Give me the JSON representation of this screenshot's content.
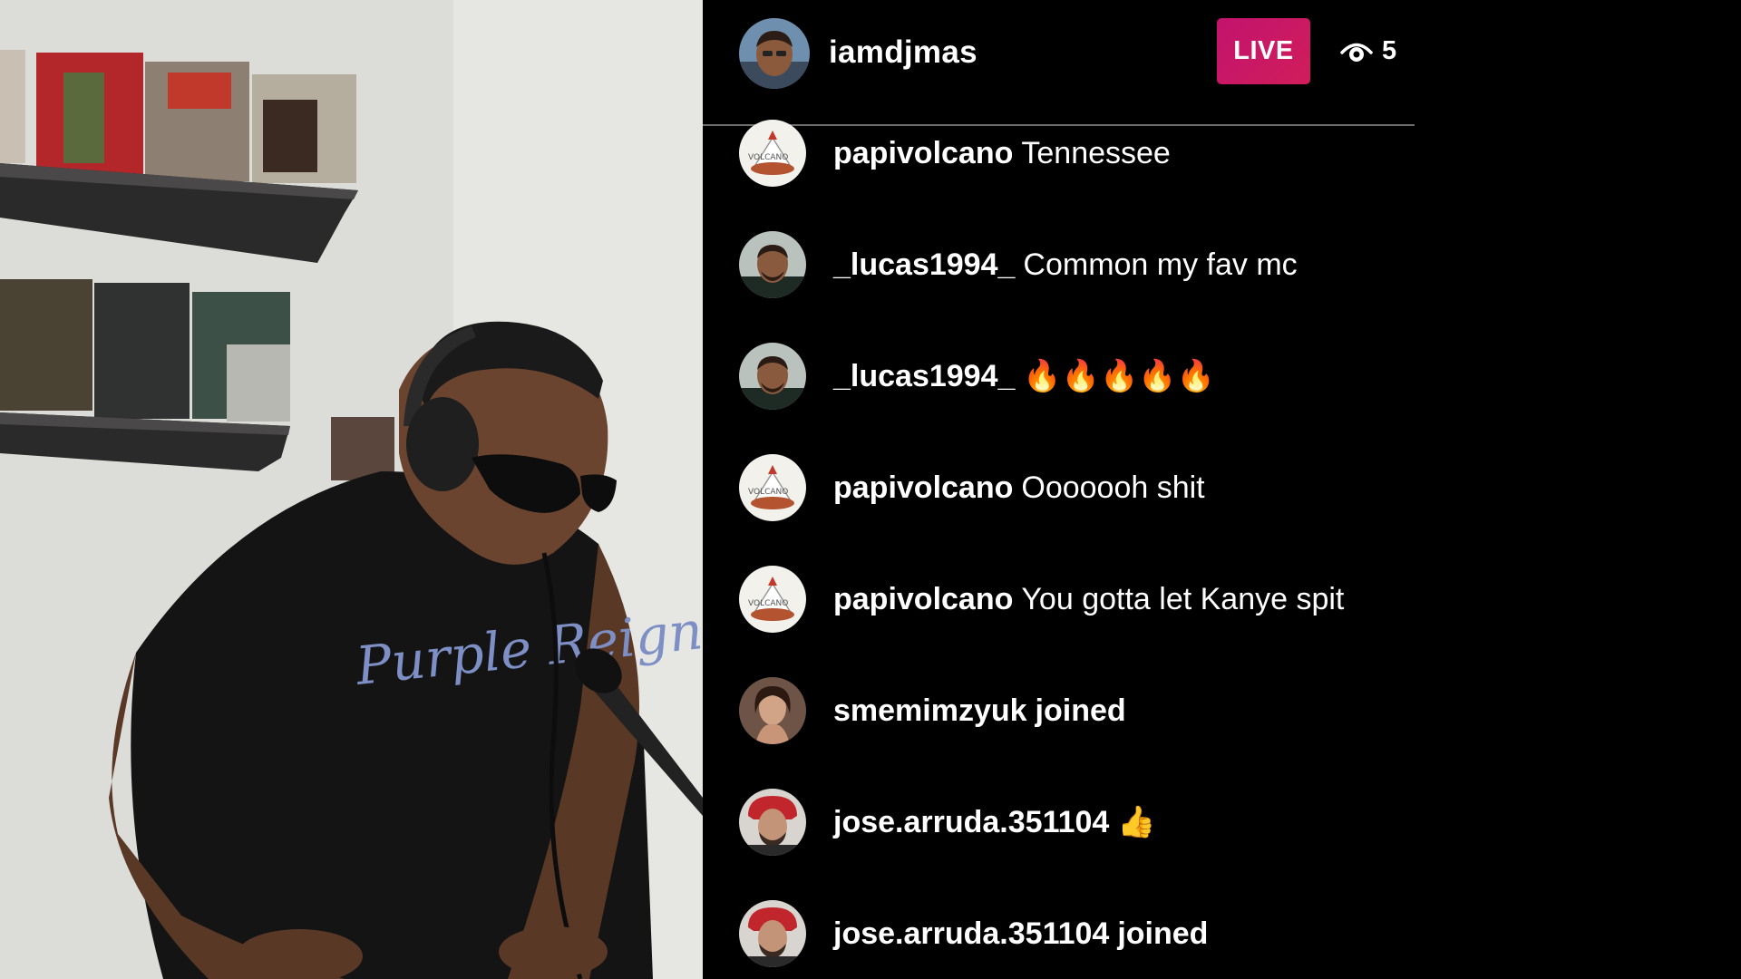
{
  "host": {
    "username": "iamdjmas",
    "avatar_icon": "host-avatar-photo",
    "live_label": "LIVE",
    "viewer_icon": "eye-icon",
    "viewer_count": "5"
  },
  "colors": {
    "live_badge": "#c2136e",
    "panel_background": "#000000",
    "text": "#ffffff"
  },
  "comments": [
    {
      "username": "papivolcano",
      "message": "Tennessee",
      "avatar": "volcano-avatar"
    },
    {
      "username": "_lucas1994_",
      "message": "Common my fav mc",
      "avatar": "lucas-avatar"
    },
    {
      "username": "_lucas1994_",
      "message": "🔥🔥🔥🔥🔥",
      "avatar": "lucas-avatar"
    },
    {
      "username": "papivolcano",
      "message": "Ooooooh shit",
      "avatar": "volcano-avatar"
    },
    {
      "username": "papivolcano",
      "message": "You gotta let Kanye spit",
      "avatar": "volcano-avatar"
    },
    {
      "username": "smemimzyuk",
      "message": "joined",
      "avatar": "smemimzyuk-avatar"
    },
    {
      "username": "jose.arruda.351104",
      "message": "👍",
      "avatar": "jose-avatar"
    },
    {
      "username": "jose.arruda.351104",
      "message": "joined",
      "avatar": "jose-avatar"
    }
  ]
}
